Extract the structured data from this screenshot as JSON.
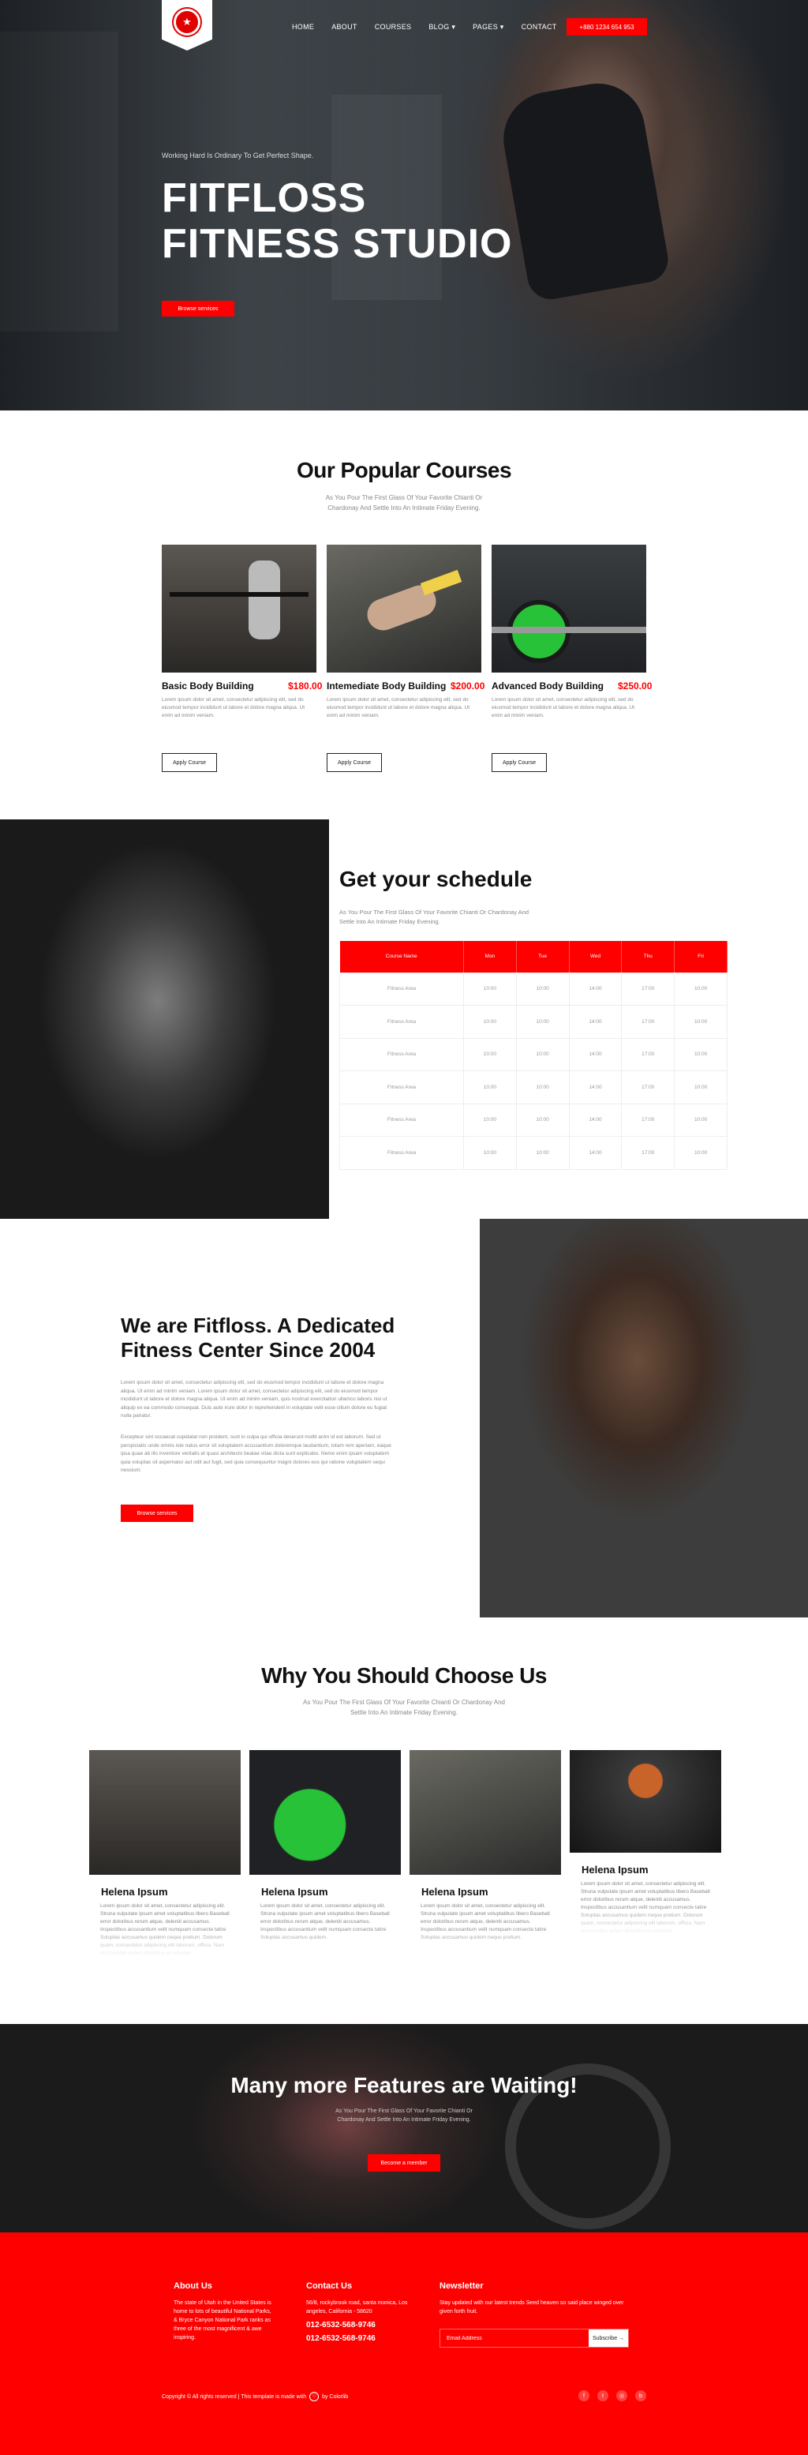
{
  "nav": {
    "logo_icon": "shield-crest-icon",
    "items": [
      {
        "label": "HOME"
      },
      {
        "label": "ABOUT"
      },
      {
        "label": "COURSES"
      },
      {
        "label": "BLOG ▾"
      },
      {
        "label": "PAGES ▾"
      },
      {
        "label": "CONTACT"
      }
    ],
    "phone_button": "+880 1234 654 953"
  },
  "hero": {
    "subtitle": "Working Hard Is Ordinary To Get Perfect Shape.",
    "title_line1": "FITFLOSS",
    "title_line2": "FITNESS STUDIO",
    "button": "Browse services"
  },
  "courses": {
    "title": "Our Popular Courses",
    "subtitle": "As You Pour The First Glass Of Your Favorite Chianti Or Chardonay And Settle Into An Intimate Friday Evening.",
    "items": [
      {
        "name": "Basic Body Building",
        "price": "$180.00",
        "desc": "Lorem ipsum dolor sit amet, consectetur adipiscing elit, sed do eiusmod tempor incididunt ut labore et dolore magna aliqua. Ut enim ad minim veniam.",
        "button": "Apply Course"
      },
      {
        "name": "Intemediate Body Building",
        "price": "$200.00",
        "desc": "Lorem ipsum dolor sit amet, consectetur adipiscing elit, sed do eiusmod tempor incididunt ut labore et dolore magna aliqua. Ut enim ad minim veniam.",
        "button": "Apply Course"
      },
      {
        "name": "Advanced Body Building",
        "price": "$250.00",
        "desc": "Lorem ipsum dolor sit amet, consectetur adipiscing elit, sed do eiusmod tempor incididunt ut labore et dolore magna aliqua. Ut enim ad minim veniam.",
        "button": "Apply Course"
      }
    ]
  },
  "schedule": {
    "title": "Get your schedule",
    "subtitle": "As You Pour The First Glass Of Your Favorite Chianti Or Chardonay And Settle Into An Intimate Friday Evening.",
    "headers": [
      "Course Name",
      "Mon",
      "Tue",
      "Wed",
      "Thu",
      "Fri"
    ],
    "rows": [
      [
        "Fitness Area",
        "10:00",
        "10:00",
        "14:00",
        "17:00",
        "10:00"
      ],
      [
        "Fitness Area",
        "10:00",
        "10:00",
        "14:00",
        "17:00",
        "10:00"
      ],
      [
        "Fitness Area",
        "10:00",
        "10:00",
        "14:00",
        "17:00",
        "10:00"
      ],
      [
        "Fitness Area",
        "10:00",
        "10:00",
        "14:00",
        "17:00",
        "10:00"
      ],
      [
        "Fitness Area",
        "10:00",
        "10:00",
        "14:00",
        "17:00",
        "10:00"
      ],
      [
        "Fitness Area",
        "10:00",
        "10:00",
        "14:00",
        "17:00",
        "10:00"
      ]
    ]
  },
  "about": {
    "title_line1": "We are Fitfloss. A Dedicated",
    "title_line2": "Fitness Center Since 2004",
    "p1": "Lorem ipsum dolor sit amet, consectetur adipiscing elit, sed do eiusmod tempor incididunt ut labore et dolore magna aliqua. Ut enim ad minim veniam. Lorem ipsum dolor sit amet, consectetur adipiscing elit, sed do eiusmod tempor incididunt ut labore et dolore magna aliqua. Ut enim ad minim veniam, quis nostrud exercitation ullamco laboris nisi ut aliquip ex ea commodo consequat. Duis aute irure dolor in reprehenderit in voluptate velit esse cillum dolore eu fugiat nulla pariatur.",
    "p2": "Excepteur sint occaecat cupidatat non proident, sunt in culpa qui officia deserunt mollit anim id est laborum. Sed ut perspiciatis unde omnis iste natus error sit voluptatem accusantium doloremque laudantium, totam rem aperiam, eaque ipsa quae ab illo inventore veritatis et quasi architecto beatae vitae dicta sunt explicabo. Nemo enim ipsam voluptatem quia voluptas sit aspernatur aut odit aut fugit, sed quia consequuntur magni dolores eos qui ratione voluptatem sequi nesciunt.",
    "button": "Browse services"
  },
  "why": {
    "title": "Why You Should Choose Us",
    "subtitle": "As You Pour The First Glass Of Your Favorite Chianti Or Chardonay And Settle Into An Intimate Friday Evening.",
    "cards": [
      {
        "name": "Helena Ipsum",
        "text": "Lorem ipsum dolor sit amet, consectetur adipiscing elit. Struna vulputate ipsum amet voluptatibus libero Baseball error doloribus rerum atque, deleniti accusamus. Inspectibus accusantium velit numquam consecte tatire Soluptas accusamus quidem neque pretium. Dolorum quam, consectetur adipiscing elit laborum, officia. Nam recusandae autem doloribus et voluptas."
      },
      {
        "name": "Helena Ipsum",
        "text": "Lorem ipsum dolor sit amet, consectetur adipiscing elit. Struna vulputate ipsum amet voluptatibus libero Baseball error doloribus rerum atque, deleniti accusamus. Inspectibus accusantium velit numquam consecte tatire Soluptas accusamus quidem."
      },
      {
        "name": "Helena Ipsum",
        "text": "Lorem ipsum dolor sit amet, consectetur adipiscing elit. Struna vulputate ipsum amet voluptatibus libero Baseball error doloribus rerum atque, deleniti accusamus. Inspectibus accusantium velit numquam consecte tatire Soluptas accusamus quidem neque pretium."
      },
      {
        "name": "Helena Ipsum",
        "text": "Lorem ipsum dolor sit amet, consectetur adipiscing elit. Struna vulputate ipsum amet voluptatibus libero Baseball error doloribus rerum atque, deleniti accusamus. Inspectibus accusantium velit numquam consecte tatire Soluptas accusamus quidem neque pretium. Dolorum quam, consectetur adipiscing elit laborum, officia. Nam recusandae autem doloribus et voluptas."
      }
    ]
  },
  "features": {
    "title": "Many more Features are Waiting!",
    "subtitle": "As You Pour The First Glass Of Your Favorite Chianti Or Chardonay And Settle Into An Intimate Friday Evening.",
    "button": "Become a member"
  },
  "footer": {
    "about_title": "About Us",
    "about_text": "The state of Utah in the United States is home to lots of beautiful National Parks, & Bryce Canyon National Park ranks as three of the most magnificent & awe inspiring.",
    "contact_title": "Contact Us",
    "address": "56/8, rockybrook road, santa monica, Los angeles, California - 58620",
    "phone1": "012-6532-568-9746",
    "phone2": "012-6532-568-9746",
    "newsletter_title": "Newsletter",
    "newsletter_text": "Stay updated with our latest trends Seed heaven so said place winged over given forth fruit.",
    "email_placeholder": "Email Address",
    "subscribe_button": "Subscribe →",
    "copyright_pre": "Copyright © All rights reserved | This template is made with",
    "copyright_post": "by Colorlib",
    "socials": [
      "facebook-icon",
      "twitter-icon",
      "instagram-icon",
      "behance-icon"
    ]
  },
  "colors": {
    "accent": "#ff0000",
    "dark": "#111111"
  }
}
